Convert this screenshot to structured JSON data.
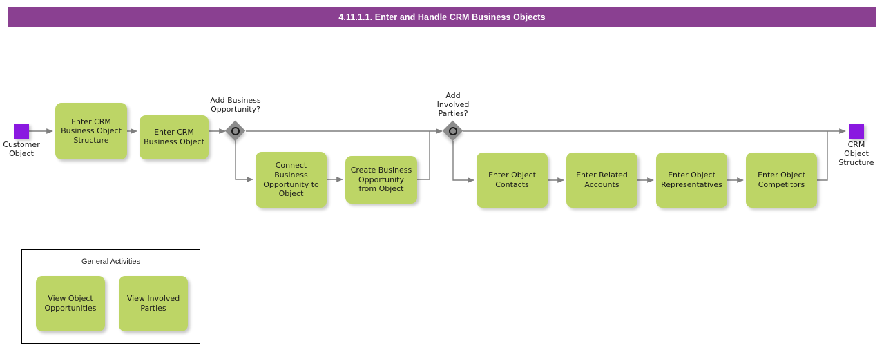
{
  "title": {
    "text": "4.11.1.1. Enter and Handle CRM Business Objects",
    "bar_color": "#8a4091"
  },
  "palette": {
    "task_fill": "#bdd566",
    "event_fill": "#8a18e0",
    "gateway_fill": "#8c8c8c",
    "connector": "#7f7f7f",
    "text": "#1a1a1a"
  },
  "events": {
    "start": {
      "label": "Customer\nObject",
      "name": "start-event"
    },
    "end": {
      "label": "CRM\nObject\nStructure",
      "name": "end-event"
    }
  },
  "gateways": [
    {
      "id": "gw1",
      "label": "Add Business\nOpportunity?",
      "type": "inclusive"
    },
    {
      "id": "gw2",
      "label": "Add\nInvolved\nParties?",
      "type": "inclusive"
    }
  ],
  "tasks": [
    {
      "id": "t1",
      "label": "Enter CRM\nBusiness Object\nStructure"
    },
    {
      "id": "t2",
      "label": "Enter CRM\nBusiness Object"
    },
    {
      "id": "t3",
      "label": "Connect\nBusiness\nOpportunity to\nObject"
    },
    {
      "id": "t4",
      "label": "Create Business\nOpportunity\nfrom Object"
    },
    {
      "id": "t5",
      "label": "Enter Object\nContacts"
    },
    {
      "id": "t6",
      "label": "Enter Related\nAccounts"
    },
    {
      "id": "t7",
      "label": "Enter Object\nRepresentatives"
    },
    {
      "id": "t8",
      "label": "Enter Object\nCompetitors"
    }
  ],
  "group": {
    "title": "General Activities",
    "tasks": [
      {
        "id": "g1",
        "label": "View Object\nOpportunities"
      },
      {
        "id": "g2",
        "label": "View Involved\nParties"
      }
    ]
  }
}
